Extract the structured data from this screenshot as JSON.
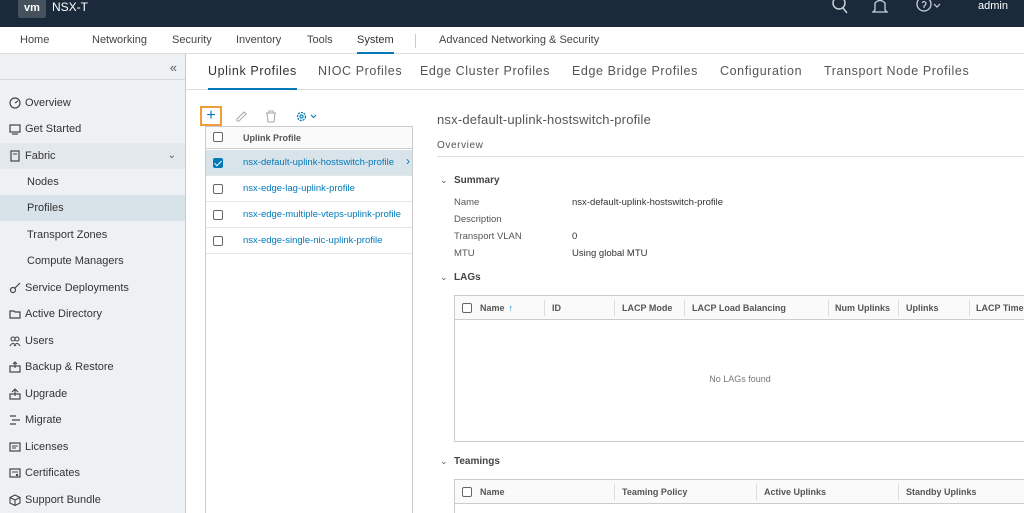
{
  "header": {
    "logo": "vm",
    "title": "NSX-T",
    "user": "admin",
    "icons": [
      "search-icon",
      "bell-icon",
      "help-icon"
    ]
  },
  "nav": {
    "items": [
      {
        "label": "Home"
      },
      {
        "label": "Networking"
      },
      {
        "label": "Security"
      },
      {
        "label": "Inventory"
      },
      {
        "label": "Tools"
      },
      {
        "label": "System",
        "active": true
      },
      {
        "label": "Advanced Networking & Security"
      }
    ]
  },
  "sidebar": {
    "collapse": "«",
    "items": [
      {
        "label": "Overview",
        "icon": "gauge-icon"
      },
      {
        "label": "Get Started",
        "icon": "monitor-icon"
      },
      {
        "label": "Fabric",
        "icon": "server-icon",
        "expanded": true
      },
      {
        "label": "Nodes"
      },
      {
        "label": "Profiles",
        "selected": true
      },
      {
        "label": "Transport Zones"
      },
      {
        "label": "Compute Managers"
      },
      {
        "label": "Service Deployments",
        "icon": "key-icon"
      },
      {
        "label": "Active Directory",
        "icon": "folder-icon"
      },
      {
        "label": "Users",
        "icon": "users-icon"
      },
      {
        "label": "Backup & Restore",
        "icon": "backup-icon"
      },
      {
        "label": "Upgrade",
        "icon": "upgrade-icon"
      },
      {
        "label": "Migrate",
        "icon": "migrate-icon"
      },
      {
        "label": "Licenses",
        "icon": "license-icon"
      },
      {
        "label": "Certificates",
        "icon": "certificate-icon"
      },
      {
        "label": "Support Bundle",
        "icon": "bundle-icon"
      }
    ]
  },
  "tabs": [
    {
      "label": "Uplink Profiles",
      "active": true
    },
    {
      "label": "NIOC Profiles"
    },
    {
      "label": "Edge Cluster Profiles"
    },
    {
      "label": "Edge Bridge Profiles"
    },
    {
      "label": "Configuration"
    },
    {
      "label": "Transport Node Profiles"
    }
  ],
  "toolbar": {
    "add": "+",
    "icons": [
      "edit-icon",
      "delete-icon",
      "gear-icon"
    ]
  },
  "profiles": {
    "header": "Uplink Profile",
    "rows": [
      {
        "name": "nsx-default-uplink-hostswitch-profile",
        "selected": true
      },
      {
        "name": "nsx-edge-lag-uplink-profile"
      },
      {
        "name": "nsx-edge-multiple-vteps-uplink-profile"
      },
      {
        "name": "nsx-edge-single-nic-uplink-profile"
      }
    ]
  },
  "detail": {
    "title": "nsx-default-uplink-hostswitch-profile",
    "tab": "Overview",
    "summary": {
      "label": "Summary",
      "fields": [
        {
          "key": "Name",
          "value": "nsx-default-uplink-hostswitch-profile"
        },
        {
          "key": "Description",
          "value": ""
        },
        {
          "key": "Transport VLAN",
          "value": "0"
        },
        {
          "key": "MTU",
          "value": "Using global MTU"
        }
      ]
    },
    "lags": {
      "label": "LAGs",
      "columns": [
        "Name",
        "ID",
        "LACP Mode",
        "LACP Load Balancing",
        "Num Uplinks",
        "Uplinks",
        "LACP Time"
      ],
      "empty": "No LAGs found"
    },
    "teamings": {
      "label": "Teamings",
      "columns": [
        "Name",
        "Teaming Policy",
        "Active Uplinks",
        "Standby Uplinks"
      ]
    }
  }
}
